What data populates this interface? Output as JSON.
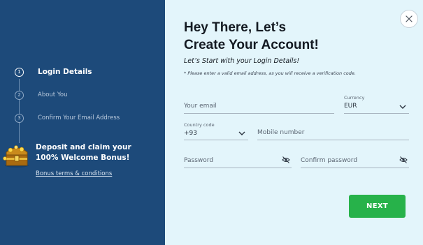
{
  "colors": {
    "left_panel": "#1d4a7a",
    "right_panel": "#e3f5fb",
    "next_button": "#27b24a",
    "text_dark": "#141a22"
  },
  "steps": [
    {
      "number": "1",
      "label": "Login Details",
      "active": true
    },
    {
      "number": "2",
      "label": "About You",
      "active": false
    },
    {
      "number": "3",
      "label": "Confirm Your Email Address",
      "active": false
    }
  ],
  "promo": {
    "line1": "Deposit and claim your",
    "line2": "100% Welcome Bonus!",
    "terms_link": "Bonus terms & conditions",
    "icon": "treasure-chest-icon"
  },
  "header": {
    "title_line1": "Hey There, Let’s",
    "title_line2": "Create Your Account!",
    "subtitle": "Let’s Start with your Login Details!",
    "note": "* Please enter a valid email address, as you will receive a verification code."
  },
  "form": {
    "email_placeholder": "Your email",
    "currency_label": "Currency",
    "currency_value": "EUR",
    "country_code_label": "Country code",
    "country_code_value": "+93",
    "mobile_placeholder": "Mobile number",
    "password_placeholder": "Password",
    "confirm_password_placeholder": "Confirm password"
  },
  "buttons": {
    "next": "NEXT",
    "close_icon": "close-icon"
  }
}
